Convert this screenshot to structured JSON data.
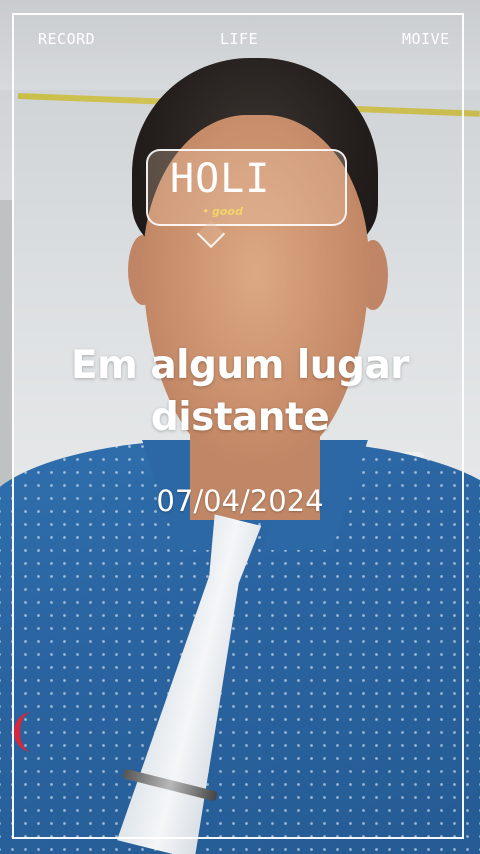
{
  "top_bar": {
    "left_label": "RECORD",
    "center_label": "LIFE",
    "right_label": "MOIVE"
  },
  "sticker": {
    "main_text": "HOLI",
    "sub_text": "good"
  },
  "caption": {
    "line1": "Em algum lugar",
    "line2": "distante"
  },
  "date_text": "07/04/2024",
  "colors": {
    "overlay_text": "#ffffff",
    "sticker_accent": "#f3d36a",
    "shirt": "#2a64a0"
  }
}
